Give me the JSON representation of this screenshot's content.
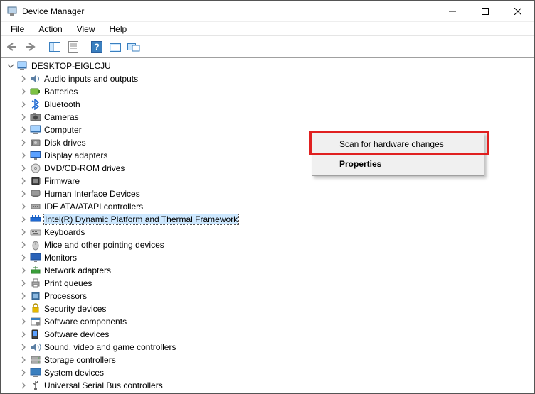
{
  "window": {
    "title": "Device Manager",
    "min_label": "Minimize",
    "max_label": "Maximize",
    "close_label": "Close"
  },
  "menu": {
    "file": "File",
    "action": "Action",
    "view": "View",
    "help": "Help"
  },
  "toolbar": {
    "back": "Back",
    "forward": "Forward",
    "show_hide": "Show/Hide Console Tree",
    "properties": "Properties",
    "help": "Help",
    "scan": "Scan for hardware changes",
    "devices": "Devices"
  },
  "tree": {
    "root": "DESKTOP-EIGLCJU",
    "items": [
      {
        "label": "Audio inputs and outputs",
        "icon": "audio"
      },
      {
        "label": "Batteries",
        "icon": "battery"
      },
      {
        "label": "Bluetooth",
        "icon": "bluetooth"
      },
      {
        "label": "Cameras",
        "icon": "camera"
      },
      {
        "label": "Computer",
        "icon": "computer"
      },
      {
        "label": "Disk drives",
        "icon": "disk"
      },
      {
        "label": "Display adapters",
        "icon": "display"
      },
      {
        "label": "DVD/CD-ROM drives",
        "icon": "dvd"
      },
      {
        "label": "Firmware",
        "icon": "firmware"
      },
      {
        "label": "Human Interface Devices",
        "icon": "hid"
      },
      {
        "label": "IDE ATA/ATAPI controllers",
        "icon": "ide"
      },
      {
        "label": "Intel(R) Dynamic Platform and Thermal Framework",
        "icon": "intel",
        "selected": true
      },
      {
        "label": "Keyboards",
        "icon": "keyboard"
      },
      {
        "label": "Mice and other pointing devices",
        "icon": "mouse"
      },
      {
        "label": "Monitors",
        "icon": "monitor"
      },
      {
        "label": "Network adapters",
        "icon": "network"
      },
      {
        "label": "Print queues",
        "icon": "printer"
      },
      {
        "label": "Processors",
        "icon": "processor"
      },
      {
        "label": "Security devices",
        "icon": "security"
      },
      {
        "label": "Software components",
        "icon": "swcomp"
      },
      {
        "label": "Software devices",
        "icon": "swdev"
      },
      {
        "label": "Sound, video and game controllers",
        "icon": "sound"
      },
      {
        "label": "Storage controllers",
        "icon": "storage"
      },
      {
        "label": "System devices",
        "icon": "system"
      },
      {
        "label": "Universal Serial Bus controllers",
        "icon": "usb"
      }
    ]
  },
  "context_menu": {
    "scan": "Scan for hardware changes",
    "properties": "Properties"
  }
}
